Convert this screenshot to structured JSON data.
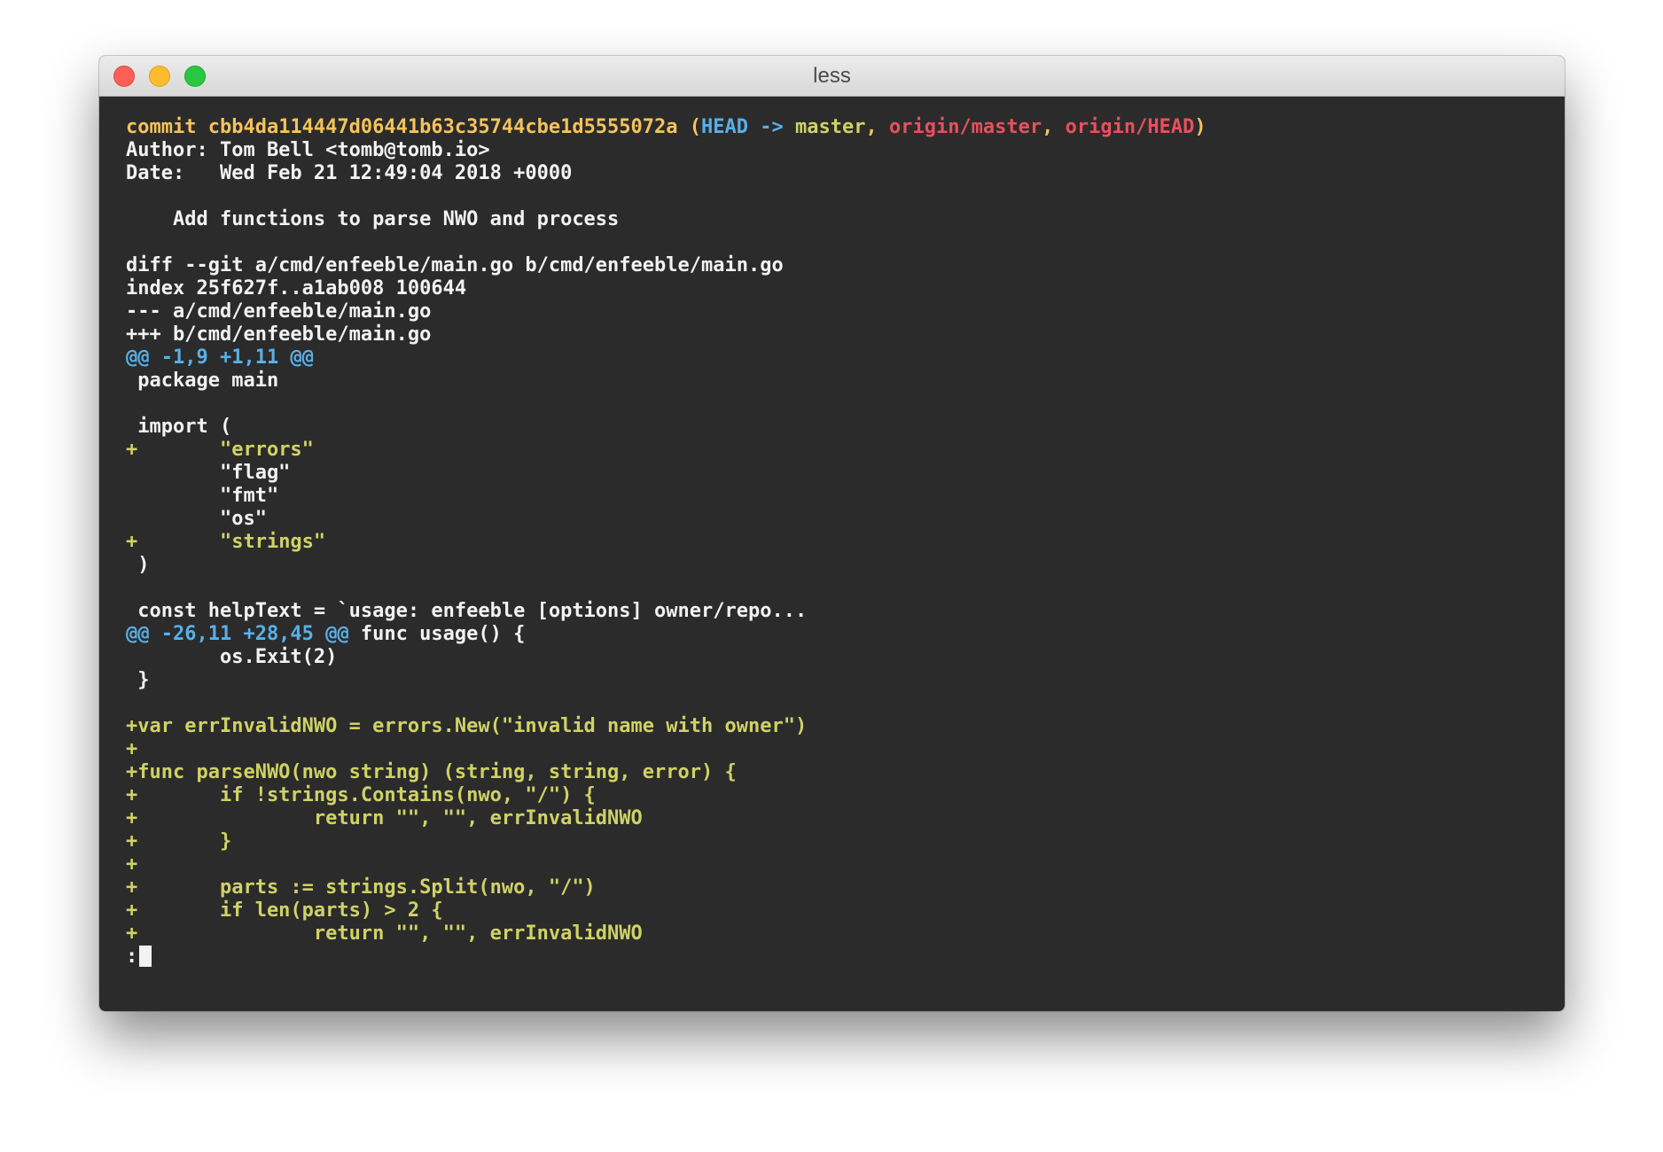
{
  "window": {
    "title": "less"
  },
  "commit": {
    "prefix": "commit ",
    "hash": "cbb4da114447d06441b63c35744cbe1d5555072a",
    "open_paren": " (",
    "head": "HEAD ->",
    "branch": " master",
    "sep1": ", ",
    "origin_master": "origin/master",
    "sep2": ", ",
    "origin_head": "origin/HEAD",
    "close_paren": ")"
  },
  "author_line": "Author: Tom Bell <tomb@tomb.io>",
  "date_line": "Date:   Wed Feb 21 12:49:04 2018 +0000",
  "message_line": "    Add functions to parse NWO and process",
  "diff_header": [
    "diff --git a/cmd/enfeeble/main.go b/cmd/enfeeble/main.go",
    "index 25f627f..a1ab008 100644",
    "--- a/cmd/enfeeble/main.go",
    "+++ b/cmd/enfeeble/main.go"
  ],
  "hunk1": {
    "header": "@@ -1,9 +1,11 @@"
  },
  "hunk1_lines": {
    "l1": " package main",
    "l2": " import (",
    "l3_marker": "+",
    "l3_text": "       \"errors\"",
    "l4": "        \"flag\"",
    "l5": "        \"fmt\"",
    "l6": "        \"os\"",
    "l7_marker": "+",
    "l7_text": "       \"strings\"",
    "l8": " )",
    "l9": " const helpText = `usage: enfeeble [options] owner/repo..."
  },
  "hunk2": {
    "header": "@@ -26,11 +28,45 @@",
    "context": " func usage() {"
  },
  "hunk2_lines": {
    "l1": "        os.Exit(2)",
    "l2": " }",
    "added": [
      "+var errInvalidNWO = errors.New(\"invalid name with owner\")",
      "+",
      "+func parseNWO(nwo string) (string, string, error) {",
      "+       if !strings.Contains(nwo, \"/\") {",
      "+               return \"\", \"\", errInvalidNWO",
      "+       }",
      "+",
      "+       parts := strings.Split(nwo, \"/\")",
      "+       if len(parts) > 2 {",
      "+               return \"\", \"\", errInvalidNWO"
    ]
  },
  "prompt": ":",
  "colors": {
    "commit_yellow": "#f5c35b",
    "head_blue": "#58b0e8",
    "origin_red": "#e8505b",
    "added_green": "#cfd264",
    "background": "#2b2b2b"
  }
}
